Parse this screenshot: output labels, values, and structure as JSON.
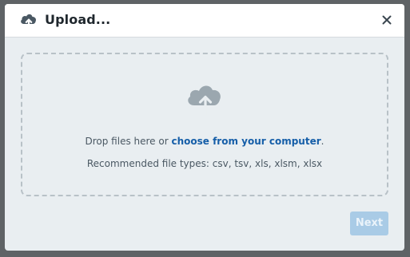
{
  "dialog": {
    "title": "Upload...",
    "title_icon": "cloud-upload-icon",
    "close_icon": "close-icon"
  },
  "dropzone": {
    "icon": "cloud-upload-icon",
    "prompt_prefix": "Drop files here or ",
    "prompt_link": "choose from your computer",
    "prompt_suffix": ".",
    "recommended": "Recommended file types: csv, tsv, xls, xlsm, xlsx"
  },
  "footer": {
    "next_label": "Next",
    "next_disabled": true
  },
  "colors": {
    "link": "#155ea8",
    "next_disabled_bg": "#a9cbe6",
    "dialog_bg": "#e9eef1"
  }
}
